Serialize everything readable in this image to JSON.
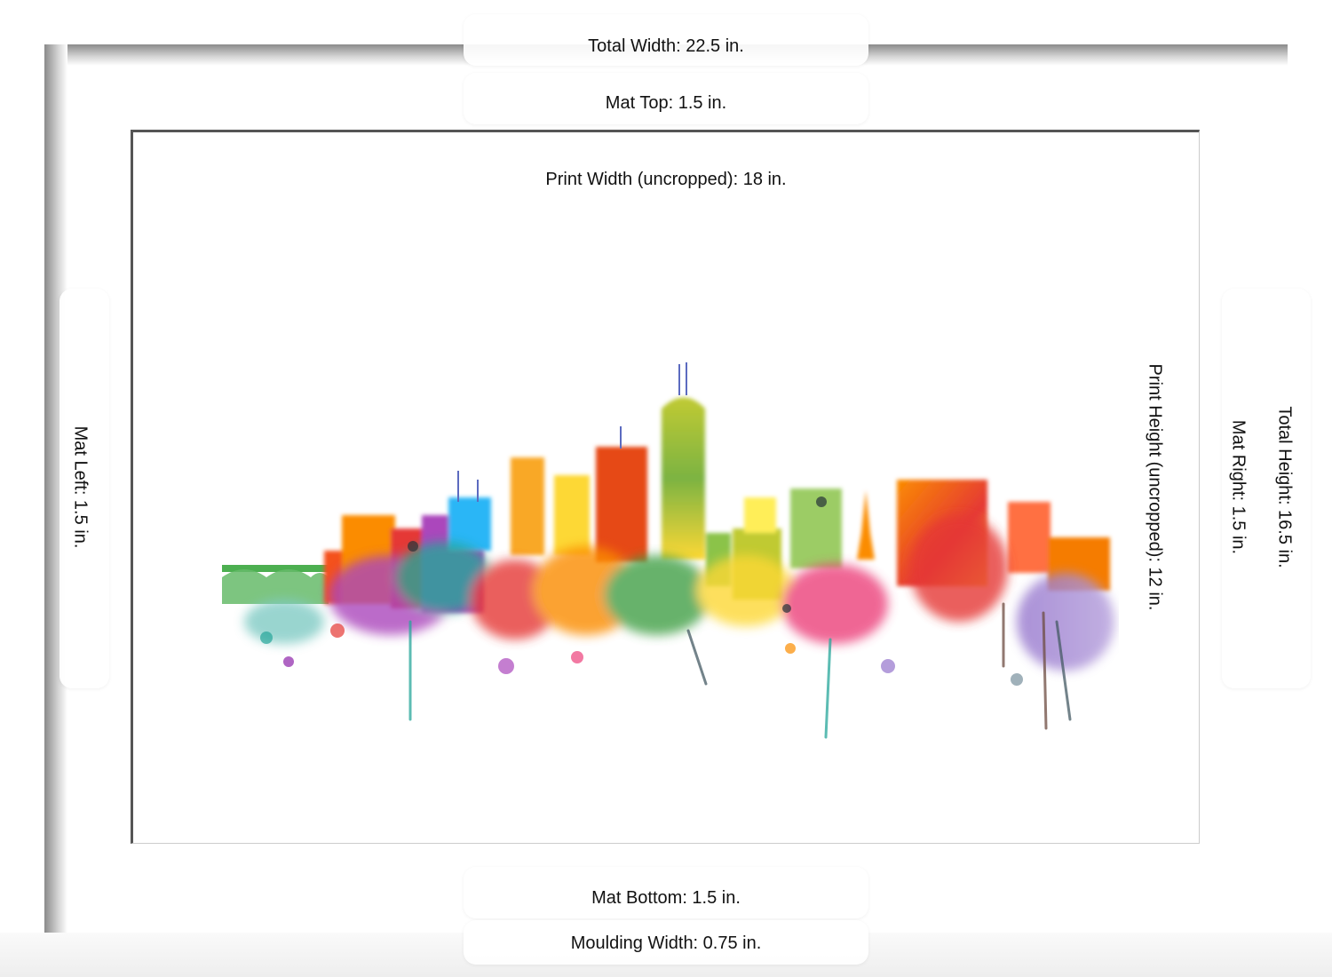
{
  "dimensions": {
    "total_width": "Total Width: 22.5 in.",
    "mat_top": "Mat Top: 1.5 in.",
    "print_width": "Print Width (uncropped): 18 in.",
    "mat_left": "Mat Left: 1.5 in.",
    "print_height": "Print Height (uncropped): 12 in.",
    "mat_right": "Mat Right: 1.5 in.",
    "total_height": "Total Height: 16.5 in.",
    "mat_bottom": "Mat Bottom: 1.5 in.",
    "moulding_width": "Moulding Width: 0.75 in."
  },
  "artwork": {
    "subject": "watercolor-city-skyline",
    "colors": [
      "#e53935",
      "#fb8c00",
      "#fdd835",
      "#7cb342",
      "#26a69a",
      "#29b6f6",
      "#8e24aa",
      "#9575cd"
    ]
  }
}
